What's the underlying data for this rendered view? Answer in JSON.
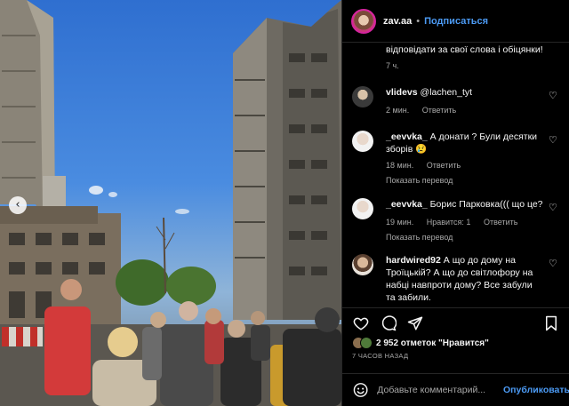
{
  "post": {
    "username": "zav.aa",
    "separator": "•",
    "follow_label": "Подписаться",
    "caption_tail": "відповідати за свої слова і обіцянки!",
    "caption_time": "7 ч."
  },
  "comments": [
    {
      "username": "vlidevs",
      "text": "@lachen_tyt",
      "time": "2 мин.",
      "reply": "Ответить",
      "likes": "",
      "translate": ""
    },
    {
      "username": "_eevvka_",
      "text": "А донати ? Були десятки зборів 😢",
      "time": "18 мин.",
      "reply": "Ответить",
      "likes": "",
      "translate": "Показать перевод"
    },
    {
      "username": "_eevvka_",
      "text": "Борис Парковка((( що це?",
      "time": "19 мин.",
      "likes": "Нравится: 1",
      "reply": "Ответить",
      "translate": "Показать перевод"
    },
    {
      "username": "hardwired92",
      "text": "А що до дому на Троїцькій? А що до світлофору на набці навпроти дому? Все забули та забили.",
      "time": "",
      "reply": "",
      "likes": "",
      "translate": ""
    }
  ],
  "actions": {
    "likes_count": "2 952 отметок \"Нравится\"",
    "time_ago": "7 ЧАСОВ НАЗАД"
  },
  "add_comment": {
    "placeholder": "Добавьте комментарий...",
    "publish_label": "Опубликовать"
  },
  "icons": {
    "heart": "heart-icon",
    "comment": "comment-icon",
    "share": "share-icon",
    "save": "bookmark-icon",
    "emoji": "emoji-icon",
    "prev": "chevron-left-icon"
  },
  "colors": {
    "accent": "#4c9bf5",
    "background": "#000000",
    "muted": "#a8a8a8"
  }
}
